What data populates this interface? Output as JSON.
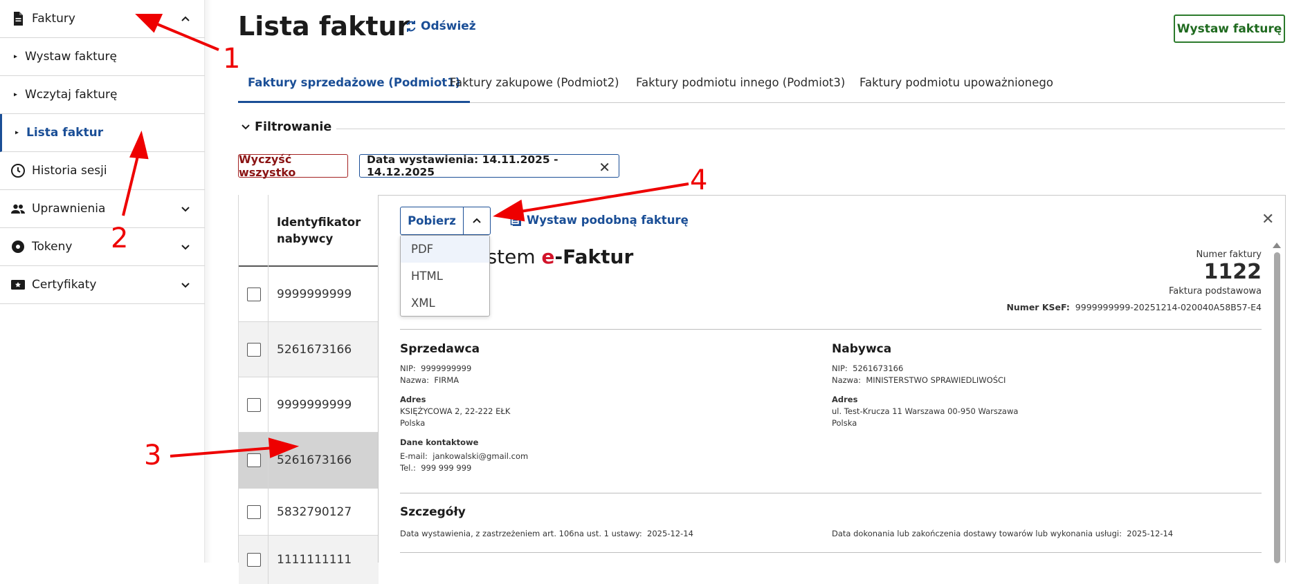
{
  "sidebar": {
    "items": [
      {
        "label": "Faktury",
        "icon": "document-icon"
      },
      {
        "label": "Wystaw fakturę"
      },
      {
        "label": "Wczytaj fakturę"
      },
      {
        "label": "Lista faktur"
      },
      {
        "label": "Historia sesji",
        "icon": "clock-icon"
      },
      {
        "label": "Uprawnienia",
        "icon": "people-icon"
      },
      {
        "label": "Tokeny",
        "icon": "token-icon"
      },
      {
        "label": "Certyfikaty",
        "icon": "certificate-icon"
      }
    ]
  },
  "header": {
    "title": "Lista faktur",
    "refresh": "Odśwież",
    "issue_button": "Wystaw fakturę"
  },
  "tabs": [
    "Faktury sprzedażowe (Podmiot1)",
    "Faktury zakupowe (Podmiot2)",
    "Faktury podmiotu innego (Podmiot3)",
    "Faktury podmiotu upoważnionego"
  ],
  "filter": {
    "heading": "Filtrowanie",
    "clear_all": "Wyczyść wszystko",
    "date_chip": "Data wystawienia: 14.11.2025 - 14.12.2025"
  },
  "table": {
    "header": [
      "Identyfikator",
      "nabywcy"
    ],
    "rows": [
      "9999999999",
      "5261673166",
      "9999999999",
      "5261673166",
      "5832790127",
      "1111111111"
    ]
  },
  "panel": {
    "download": "Pobierz",
    "similar": "Wystaw podobną fakturę",
    "menu": [
      "PDF",
      "HTML",
      "XML"
    ],
    "logo_pre": "ystem ",
    "logo_e": "e",
    "logo_post": "-Faktur",
    "invoice_number_label": "Numer faktury",
    "invoice_number": "1122",
    "invoice_type": "Faktura podstawowa",
    "ksef_label": "Numer KSeF:",
    "ksef_value": "9999999999-20251214-020040A58B57-E4",
    "seller": {
      "heading": "Sprzedawca",
      "nip_label": "NIP:",
      "nip": "9999999999",
      "name_label": "Nazwa:",
      "name": "FIRMA",
      "address_label": "Adres",
      "address1": "KSIĘŻYCOWA 2, 22-222 EŁK",
      "address2": "Polska",
      "contact_label": "Dane kontaktowe",
      "email_label": "E-mail:",
      "email": "jankowalski@gmail.com",
      "tel_label": "Tel.:",
      "tel": "999 999 999"
    },
    "buyer": {
      "heading": "Nabywca",
      "nip_label": "NIP:",
      "nip": "5261673166",
      "name_label": "Nazwa:",
      "name": "MINISTERSTWO SPRAWIEDLIWOŚCI",
      "address_label": "Adres",
      "address1": "ul. Test-Krucza 11 Warszawa 00-950 Warszawa",
      "address2": "Polska"
    },
    "details": {
      "heading": "Szczegóły",
      "issue_date_label": "Data wystawienia, z zastrzeżeniem art. 106na ust. 1 ustawy:",
      "issue_date": "2025-12-14",
      "delivery_label": "Data dokonania lub zakończenia dostawy towarów lub wykonania usługi:",
      "delivery_date": "2025-12-14"
    }
  },
  "annotations": [
    "1",
    "2",
    "3",
    "4"
  ],
  "colors": {
    "accent": "#1a4e96",
    "green": "#1f6a1f",
    "danger": "#8a1414",
    "annotation": "#e00000"
  }
}
